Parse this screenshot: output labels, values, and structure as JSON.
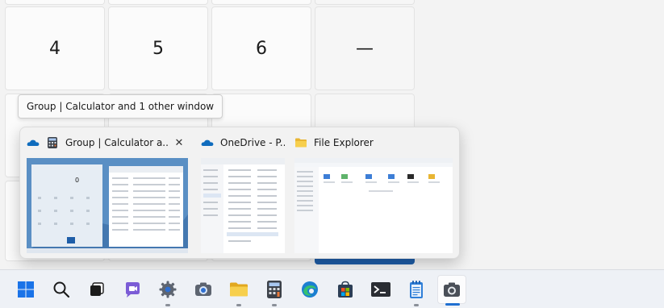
{
  "calculator": {
    "keys": {
      "four": "4",
      "five": "5",
      "six": "6",
      "minus": "—"
    },
    "preview_display": "0"
  },
  "tooltip": {
    "text": "Group | Calculator and 1 other window"
  },
  "thumbnails": [
    {
      "title": "Group | Calculator a...",
      "icons": [
        "onedrive-icon",
        "calculator-icon"
      ],
      "has_close": true,
      "close_glyph": "✕"
    },
    {
      "title": "OneDrive - P...",
      "icons": [
        "onedrive-icon"
      ],
      "has_close": false
    },
    {
      "title": "File Explorer",
      "icons": [
        "folder-icon"
      ],
      "has_close": false
    }
  ],
  "taskbar": {
    "items": [
      {
        "name": "start-icon",
        "running": false,
        "active": false
      },
      {
        "name": "search-icon",
        "running": false,
        "active": false
      },
      {
        "name": "task-view-icon",
        "running": false,
        "active": false
      },
      {
        "name": "chat-icon",
        "running": false,
        "active": false
      },
      {
        "name": "settings-icon",
        "running": true,
        "active": false
      },
      {
        "name": "camera-app-icon",
        "running": false,
        "active": false
      },
      {
        "name": "file-explorer-icon",
        "running": true,
        "active": false
      },
      {
        "name": "calculator-icon",
        "running": true,
        "active": false
      },
      {
        "name": "edge-icon",
        "running": false,
        "active": false
      },
      {
        "name": "microsoft-store-icon",
        "running": false,
        "active": false
      },
      {
        "name": "terminal-icon",
        "running": false,
        "active": false
      },
      {
        "name": "notepad-icon",
        "running": true,
        "active": false
      },
      {
        "name": "snipping-tool-icon",
        "running": true,
        "active": true
      }
    ]
  },
  "colors": {
    "accent": "#1f6fd1",
    "calc_accent_key": "#1f5ea8",
    "taskbar_bg": "#eef1f6",
    "flyout_bg": "#f2f2f2"
  }
}
